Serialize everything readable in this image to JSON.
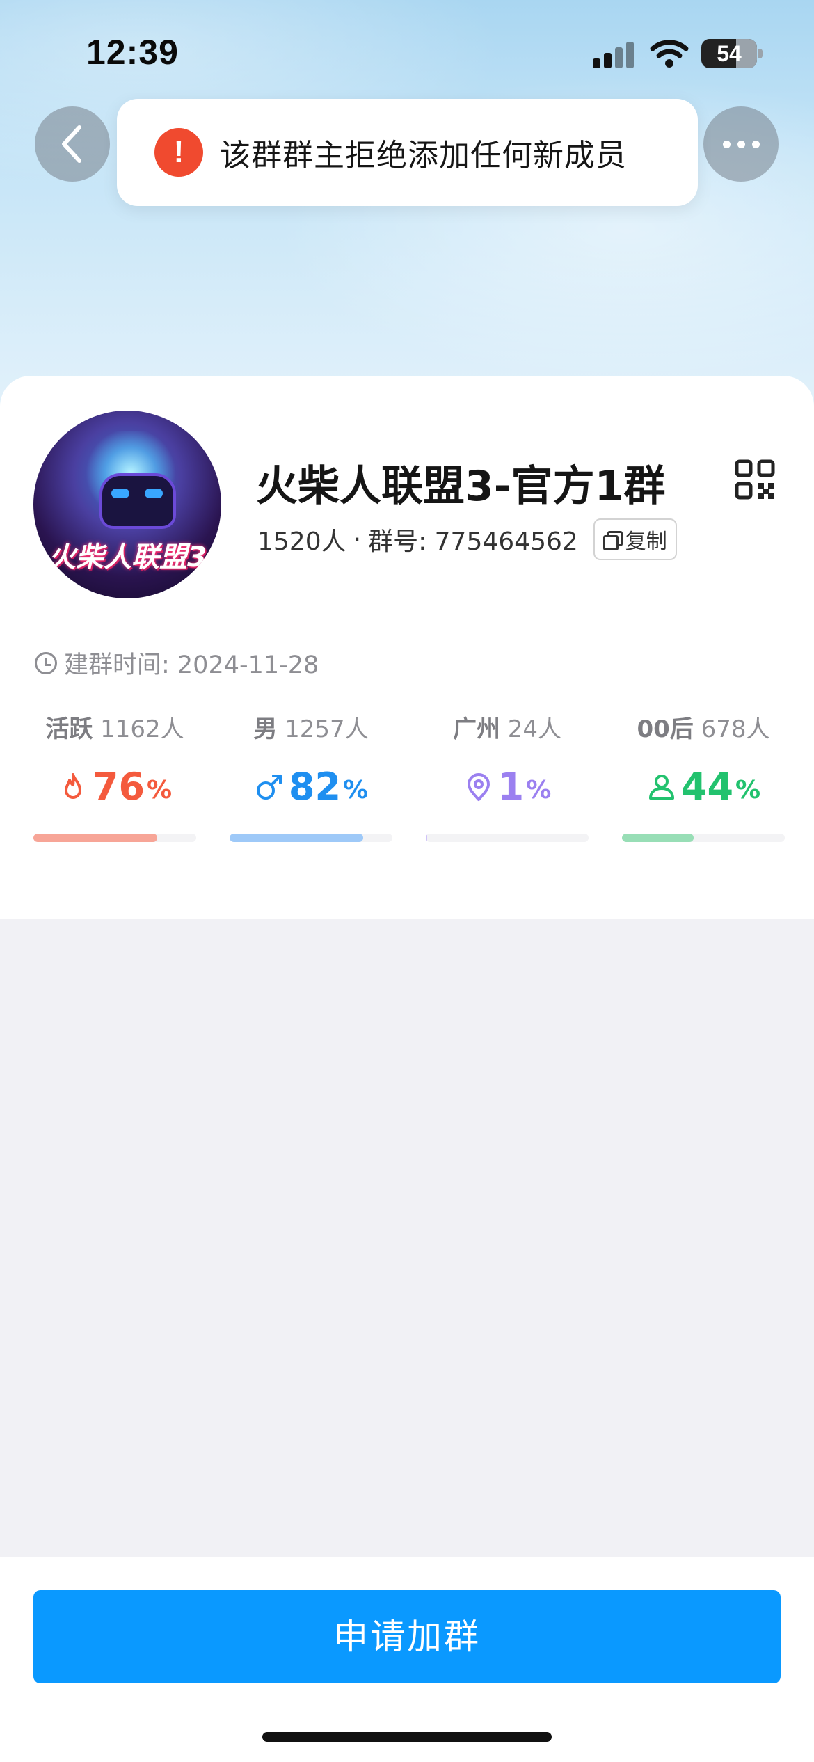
{
  "status_bar": {
    "time": "12:39",
    "battery": "54",
    "icons": [
      "signal-icon",
      "wifi-icon",
      "battery-icon"
    ]
  },
  "nav": {
    "back_icon": "chevron-left-icon",
    "more_icon": "more-dots-icon"
  },
  "toast": {
    "icon": "error-exclamation-icon",
    "icon_glyph": "!",
    "message": "该群群主拒绝添加任何新成员"
  },
  "group": {
    "avatar_caption": "火柴人联盟3",
    "name": "火柴人联盟3-官方1群",
    "member_count": "1520人",
    "separator": "·",
    "group_id_label": "群号: 775464562",
    "copy_label": "复制",
    "created_label": "建群时间: 2024-11-28"
  },
  "stats": [
    {
      "label_bold": "活跃",
      "label_rest": "1162人",
      "value": "76",
      "unit": "%",
      "fraction": 0.76,
      "color": "#f45a3d",
      "bar_color": "#f7a597",
      "icon": "flame-icon"
    },
    {
      "label_bold": "男",
      "label_rest": "1257人",
      "value": "82",
      "unit": "%",
      "fraction": 0.82,
      "color": "#1f8ff0",
      "bar_color": "#9ec9f8",
      "icon": "male-icon"
    },
    {
      "label_bold": "广州",
      "label_rest": "24人",
      "value": "1",
      "unit": "%",
      "fraction": 0.01,
      "color": "#9b80f0",
      "bar_color": "#cfc2f8",
      "icon": "location-pin-icon"
    },
    {
      "label_bold": "00后",
      "label_rest": "678人",
      "value": "44",
      "unit": "%",
      "fraction": 0.44,
      "color": "#22c26e",
      "bar_color": "#98deb6",
      "icon": "person-icon"
    }
  ],
  "actions": {
    "join_label": "申请加群"
  },
  "colors": {
    "primary": "#0a99ff",
    "error": "#f04a2f"
  }
}
